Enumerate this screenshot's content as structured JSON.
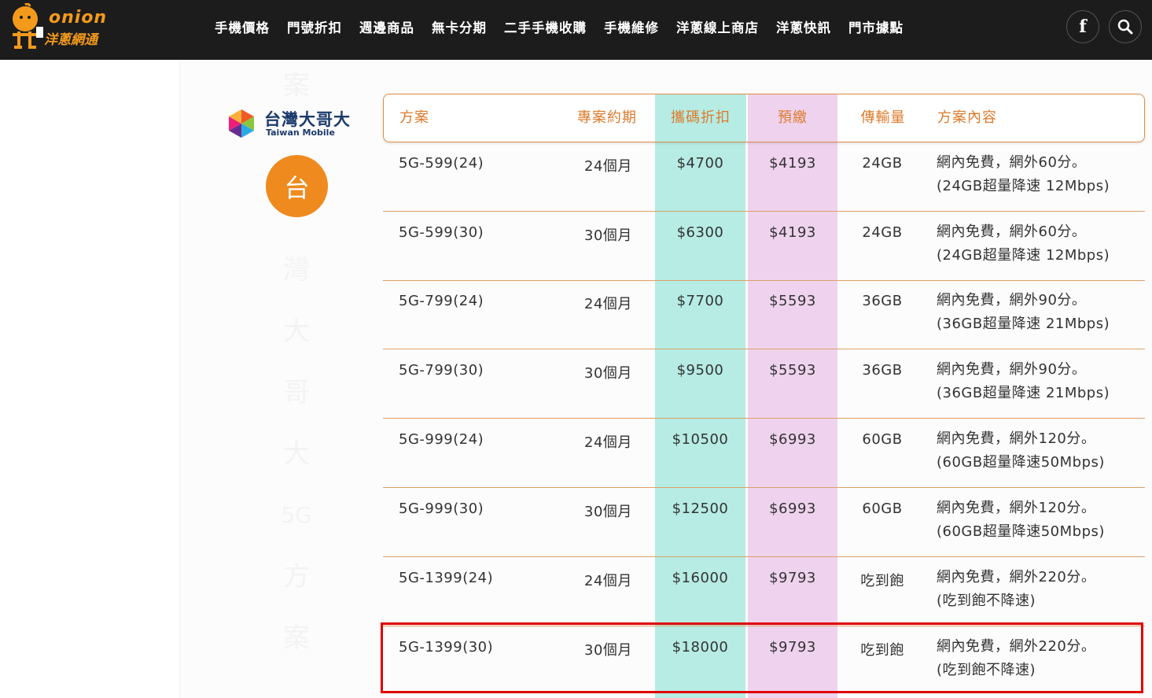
{
  "brand": {
    "logo_word": "onion",
    "logo_sub": "洋蔥網通",
    "colors": {
      "orange": "#f39a1c",
      "topbar": "#1c1c1c",
      "highlight": "#e00000"
    }
  },
  "nav": {
    "items": [
      "手機價格",
      "門號折扣",
      "週邊商品",
      "無卡分期",
      "二手手機收購",
      "手機維修",
      "洋蔥線上商店",
      "洋蔥快訊",
      "門市據點"
    ],
    "facebook_label": "f"
  },
  "carrier": {
    "name_zh": "台灣大哥大",
    "name_en": "Taiwan Mobile",
    "badge": "台",
    "vertical_title": [
      "案",
      "灣",
      "大",
      "哥",
      "大",
      "5G",
      "方",
      "案"
    ]
  },
  "table": {
    "headers": [
      "方案",
      "專案約期",
      "攜碼折扣",
      "預繳",
      "傳輸量",
      "方案內容"
    ],
    "rows": [
      {
        "plan": "5G-599(24)",
        "term": "24個月",
        "discount": "$4700",
        "prepay": "$4193",
        "data": "24GB",
        "desc1": "網內免費，網外60分。",
        "desc2": "(24GB超量降速 12Mbps)"
      },
      {
        "plan": "5G-599(30)",
        "term": "30個月",
        "discount": "$6300",
        "prepay": "$4193",
        "data": "24GB",
        "desc1": "網內免費，網外60分。",
        "desc2": "(24GB超量降速 12Mbps)"
      },
      {
        "plan": "5G-799(24)",
        "term": "24個月",
        "discount": "$7700",
        "prepay": "$5593",
        "data": "36GB",
        "desc1": "網內免費，網外90分。",
        "desc2": "(36GB超量降速 21Mbps)"
      },
      {
        "plan": "5G-799(30)",
        "term": "30個月",
        "discount": "$9500",
        "prepay": "$5593",
        "data": "36GB",
        "desc1": "網內免費，網外90分。",
        "desc2": "(36GB超量降速 21Mbps)"
      },
      {
        "plan": "5G-999(24)",
        "term": "24個月",
        "discount": "$10500",
        "prepay": "$6993",
        "data": "60GB",
        "desc1": "網內免費，網外120分。",
        "desc2": "(60GB超量降速50Mbps)"
      },
      {
        "plan": "5G-999(30)",
        "term": "30個月",
        "discount": "$12500",
        "prepay": "$6993",
        "data": "60GB",
        "desc1": "網內免費，網外120分。",
        "desc2": "(60GB超量降速50Mbps)"
      },
      {
        "plan": "5G-1399(24)",
        "term": "24個月",
        "discount": "$16000",
        "prepay": "$9793",
        "data": "吃到飽",
        "desc1": "網內免費，網外220分。",
        "desc2": "(吃到飽不降速)"
      },
      {
        "plan": "5G-1399(30)",
        "term": "30個月",
        "discount": "$18000",
        "prepay": "$9793",
        "data": "吃到飽",
        "desc1": "網內免費，網外220分。",
        "desc2": "(吃到飽不降速)"
      }
    ]
  }
}
